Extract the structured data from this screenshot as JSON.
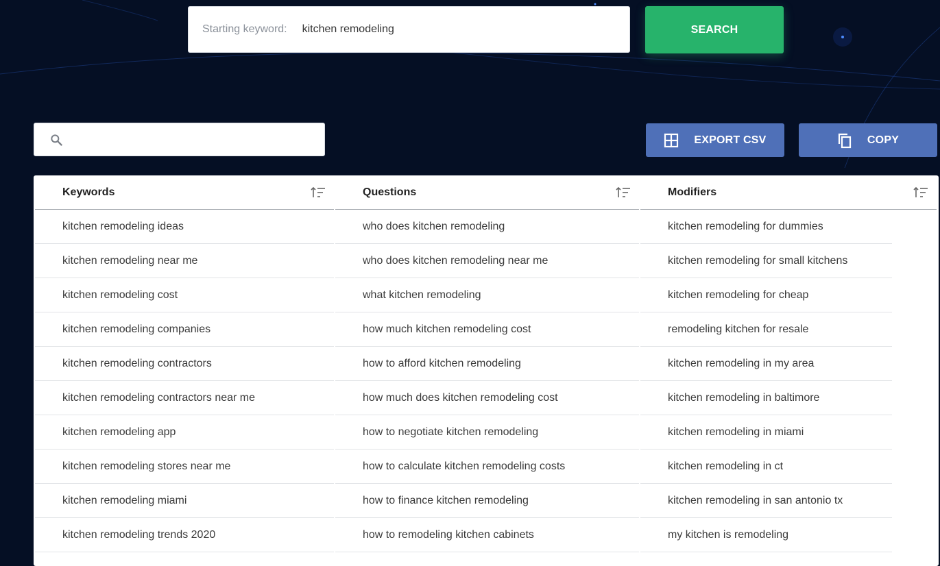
{
  "search": {
    "label": "Starting keyword:",
    "value": "kitchen remodeling",
    "button": "SEARCH"
  },
  "toolbar": {
    "filter_placeholder": "",
    "export_label": "EXPORT CSV",
    "copy_label": "COPY"
  },
  "table": {
    "headers": [
      "Keywords",
      "Questions",
      "Modifiers"
    ],
    "keywords": [
      "kitchen remodeling ideas",
      "kitchen remodeling near me",
      "kitchen remodeling cost",
      "kitchen remodeling companies",
      "kitchen remodeling contractors",
      "kitchen remodeling contractors near me",
      "kitchen remodeling app",
      "kitchen remodeling stores near me",
      "kitchen remodeling miami",
      "kitchen remodeling trends 2020"
    ],
    "questions": [
      "who does kitchen remodeling",
      "who does kitchen remodeling near me",
      "what kitchen remodeling",
      "how much kitchen remodeling cost",
      "how to afford kitchen remodeling",
      "how much does kitchen remodeling cost",
      "how to negotiate kitchen remodeling",
      "how to calculate kitchen remodeling costs",
      "how to finance kitchen remodeling",
      "how to remodeling kitchen cabinets"
    ],
    "modifiers": [
      "kitchen remodeling for dummies",
      "kitchen remodeling for small kitchens",
      "kitchen remodeling for cheap",
      "remodeling kitchen for resale",
      "kitchen remodeling in my area",
      "kitchen remodeling in baltimore",
      "kitchen remodeling in miami",
      "kitchen remodeling in ct",
      "kitchen remodeling in san antonio tx",
      "my kitchen is remodeling"
    ]
  },
  "colors": {
    "background": "#050f24",
    "search_button": "#27b36b",
    "action_button": "#4f70b8"
  },
  "icons": [
    "search-icon",
    "grid-icon",
    "copy-icon",
    "sort-icon"
  ]
}
